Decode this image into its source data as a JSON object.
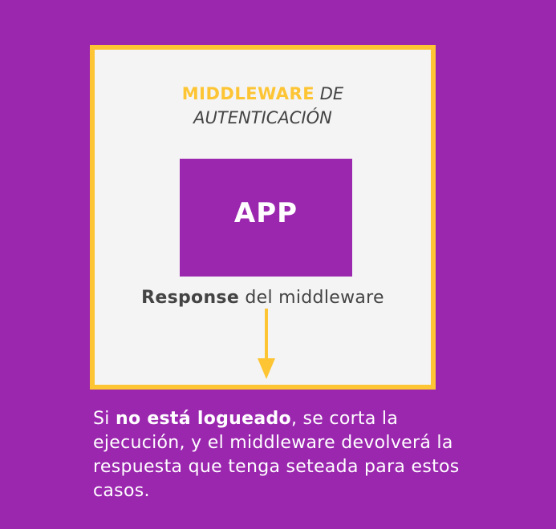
{
  "colors": {
    "background": "#9b27af",
    "box_fill": "#f4f4f4",
    "accent_yellow": "#fdc534",
    "app_fill": "#9b27af",
    "text_dark": "#444444",
    "text_light": "#ffffff"
  },
  "diagram": {
    "title_highlight": "MIDDLEWARE",
    "title_rest_line1": "DE",
    "title_line2": "AUTENTICACIÓN",
    "app_label": "APP",
    "response_bold": "Response",
    "response_rest": "del middleware",
    "arrow_icon": "down-arrow-icon"
  },
  "caption": {
    "prefix": "Si",
    "bold": "no está logueado",
    "line1_rest": ", se corta la",
    "line2": "ejecución,  y el middleware devolverá la",
    "line3": "respuesta que tenga seteada para estos",
    "line4": "casos."
  }
}
